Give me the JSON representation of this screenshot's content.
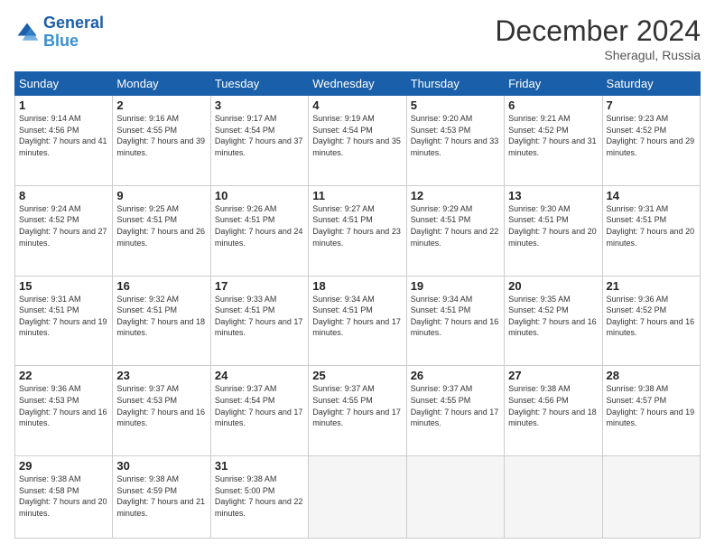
{
  "logo": {
    "line1": "General",
    "line2": "Blue"
  },
  "title": "December 2024",
  "location": "Sheragul, Russia",
  "days_of_week": [
    "Sunday",
    "Monday",
    "Tuesday",
    "Wednesday",
    "Thursday",
    "Friday",
    "Saturday"
  ],
  "weeks": [
    [
      {
        "day": "1",
        "sunrise": "9:14 AM",
        "sunset": "4:56 PM",
        "daylight": "7 hours and 41 minutes."
      },
      {
        "day": "2",
        "sunrise": "9:16 AM",
        "sunset": "4:55 PM",
        "daylight": "7 hours and 39 minutes."
      },
      {
        "day": "3",
        "sunrise": "9:17 AM",
        "sunset": "4:54 PM",
        "daylight": "7 hours and 37 minutes."
      },
      {
        "day": "4",
        "sunrise": "9:19 AM",
        "sunset": "4:54 PM",
        "daylight": "7 hours and 35 minutes."
      },
      {
        "day": "5",
        "sunrise": "9:20 AM",
        "sunset": "4:53 PM",
        "daylight": "7 hours and 33 minutes."
      },
      {
        "day": "6",
        "sunrise": "9:21 AM",
        "sunset": "4:52 PM",
        "daylight": "7 hours and 31 minutes."
      },
      {
        "day": "7",
        "sunrise": "9:23 AM",
        "sunset": "4:52 PM",
        "daylight": "7 hours and 29 minutes."
      }
    ],
    [
      {
        "day": "8",
        "sunrise": "9:24 AM",
        "sunset": "4:52 PM",
        "daylight": "7 hours and 27 minutes."
      },
      {
        "day": "9",
        "sunrise": "9:25 AM",
        "sunset": "4:51 PM",
        "daylight": "7 hours and 26 minutes."
      },
      {
        "day": "10",
        "sunrise": "9:26 AM",
        "sunset": "4:51 PM",
        "daylight": "7 hours and 24 minutes."
      },
      {
        "day": "11",
        "sunrise": "9:27 AM",
        "sunset": "4:51 PM",
        "daylight": "7 hours and 23 minutes."
      },
      {
        "day": "12",
        "sunrise": "9:29 AM",
        "sunset": "4:51 PM",
        "daylight": "7 hours and 22 minutes."
      },
      {
        "day": "13",
        "sunrise": "9:30 AM",
        "sunset": "4:51 PM",
        "daylight": "7 hours and 20 minutes."
      },
      {
        "day": "14",
        "sunrise": "9:31 AM",
        "sunset": "4:51 PM",
        "daylight": "7 hours and 20 minutes."
      }
    ],
    [
      {
        "day": "15",
        "sunrise": "9:31 AM",
        "sunset": "4:51 PM",
        "daylight": "7 hours and 19 minutes."
      },
      {
        "day": "16",
        "sunrise": "9:32 AM",
        "sunset": "4:51 PM",
        "daylight": "7 hours and 18 minutes."
      },
      {
        "day": "17",
        "sunrise": "9:33 AM",
        "sunset": "4:51 PM",
        "daylight": "7 hours and 17 minutes."
      },
      {
        "day": "18",
        "sunrise": "9:34 AM",
        "sunset": "4:51 PM",
        "daylight": "7 hours and 17 minutes."
      },
      {
        "day": "19",
        "sunrise": "9:34 AM",
        "sunset": "4:51 PM",
        "daylight": "7 hours and 16 minutes."
      },
      {
        "day": "20",
        "sunrise": "9:35 AM",
        "sunset": "4:52 PM",
        "daylight": "7 hours and 16 minutes."
      },
      {
        "day": "21",
        "sunrise": "9:36 AM",
        "sunset": "4:52 PM",
        "daylight": "7 hours and 16 minutes."
      }
    ],
    [
      {
        "day": "22",
        "sunrise": "9:36 AM",
        "sunset": "4:53 PM",
        "daylight": "7 hours and 16 minutes."
      },
      {
        "day": "23",
        "sunrise": "9:37 AM",
        "sunset": "4:53 PM",
        "daylight": "7 hours and 16 minutes."
      },
      {
        "day": "24",
        "sunrise": "9:37 AM",
        "sunset": "4:54 PM",
        "daylight": "7 hours and 17 minutes."
      },
      {
        "day": "25",
        "sunrise": "9:37 AM",
        "sunset": "4:55 PM",
        "daylight": "7 hours and 17 minutes."
      },
      {
        "day": "26",
        "sunrise": "9:37 AM",
        "sunset": "4:55 PM",
        "daylight": "7 hours and 17 minutes."
      },
      {
        "day": "27",
        "sunrise": "9:38 AM",
        "sunset": "4:56 PM",
        "daylight": "7 hours and 18 minutes."
      },
      {
        "day": "28",
        "sunrise": "9:38 AM",
        "sunset": "4:57 PM",
        "daylight": "7 hours and 19 minutes."
      }
    ],
    [
      {
        "day": "29",
        "sunrise": "9:38 AM",
        "sunset": "4:58 PM",
        "daylight": "7 hours and 20 minutes."
      },
      {
        "day": "30",
        "sunrise": "9:38 AM",
        "sunset": "4:59 PM",
        "daylight": "7 hours and 21 minutes."
      },
      {
        "day": "31",
        "sunrise": "9:38 AM",
        "sunset": "5:00 PM",
        "daylight": "7 hours and 22 minutes."
      },
      null,
      null,
      null,
      null
    ]
  ]
}
